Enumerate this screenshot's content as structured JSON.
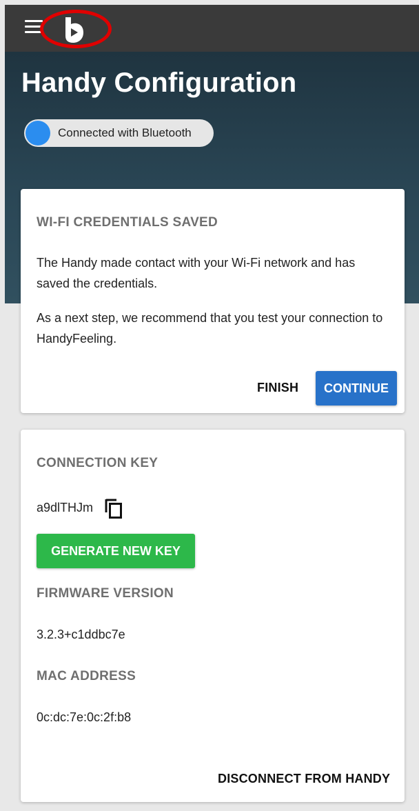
{
  "header": {
    "menu_icon": "hamburger-menu-icon",
    "logo_icon": "handy-logo-icon",
    "annotation_color": "#e00000"
  },
  "hero": {
    "title": "Handy Configuration",
    "bluetooth_toggle": {
      "label": "Connected with Bluetooth",
      "on": true,
      "color": "#2b8def"
    }
  },
  "wifi_card": {
    "title": "WI-FI CREDENTIALS SAVED",
    "paragraph1": "The Handy made contact with your Wi-Fi network and has saved the credentials.",
    "paragraph2": "As a next step, we recommend that you test your connection to HandyFeeling.",
    "finish_label": "FINISH",
    "continue_label": "CONTINUE",
    "continue_color": "#2872c9"
  },
  "device_card": {
    "connection_key_title": "CONNECTION KEY",
    "connection_key": "a9dlTHJm",
    "copy_icon": "copy-icon",
    "generate_label": "GENERATE NEW KEY",
    "generate_color": "#2db84a",
    "firmware_title": "FIRMWARE VERSION",
    "firmware_version": "3.2.3+c1ddbc7e",
    "mac_title": "MAC ADDRESS",
    "mac_address": "0c:dc:7e:0c:2f:b8",
    "disconnect_label": "DISCONNECT FROM HANDY"
  }
}
